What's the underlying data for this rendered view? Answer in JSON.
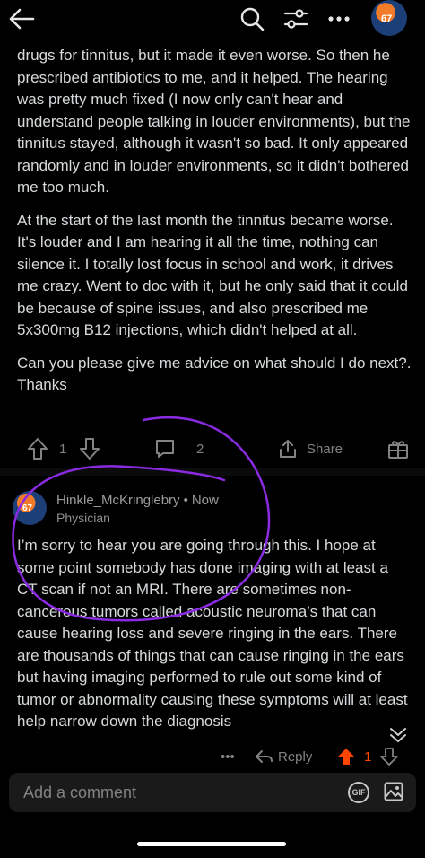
{
  "post": {
    "paragraphs": [
      "drugs for tinnitus, but it made it even worse. So then he prescribed antibiotics to me, and it helped. The hearing was pretty much fixed (I now only can't hear and understand people talking in louder environments), but the tinnitus stayed, although it wasn't so bad. It only appeared randomly and in louder environments, so it didn't bothered me too much.",
      "At the start of the last month the tinnitus became worse. It's louder and I am hearing it all the time, nothing can silence it. I totally lost focus in school and work, it drives me crazy. Went to doc with it, but he only said that it could be because of spine issues, and also prescribed me 5x300mg B12 injections, which didn't helped at all.",
      "Can you please give me advice on what should I do next?. Thanks"
    ],
    "vote_count": "1",
    "comment_count": "2",
    "share_label": "Share"
  },
  "comment": {
    "author": "Hinkle_McKringlebry",
    "separator": "•",
    "time": "Now",
    "flair": "Physician",
    "body": "I’m sorry to hear you are going through this. I hope at some point somebody has done imaging with at least a CT scan if not an MRI. There are sometimes non-cancerous tumors called acoustic neuroma’s that can cause hearing loss and severe ringing in the ears. There are thousands of things that can cause ringing in the ears but having imaging performed to rule out some kind of tumor or abnormality causing these symptoms will at least help narrow down the diagnosis",
    "more_label": "•••",
    "reply_label": "Reply",
    "vote_count": "1"
  },
  "composer": {
    "placeholder": "Add a comment",
    "gif_label": "GIF"
  },
  "avatar": {
    "number": "67"
  },
  "colors": {
    "background": "#000000",
    "text": "#d7dadc",
    "muted": "#818384",
    "upvote_active": "#ff4500",
    "annotation": "#8a2be2"
  },
  "icons": [
    "back-arrow-icon",
    "search-icon",
    "filter-icon",
    "more-icon",
    "upvote-icon",
    "downvote-icon",
    "comment-icon",
    "share-icon",
    "award-icon",
    "reply-icon",
    "collapse-icon",
    "gif-icon",
    "image-icon"
  ]
}
